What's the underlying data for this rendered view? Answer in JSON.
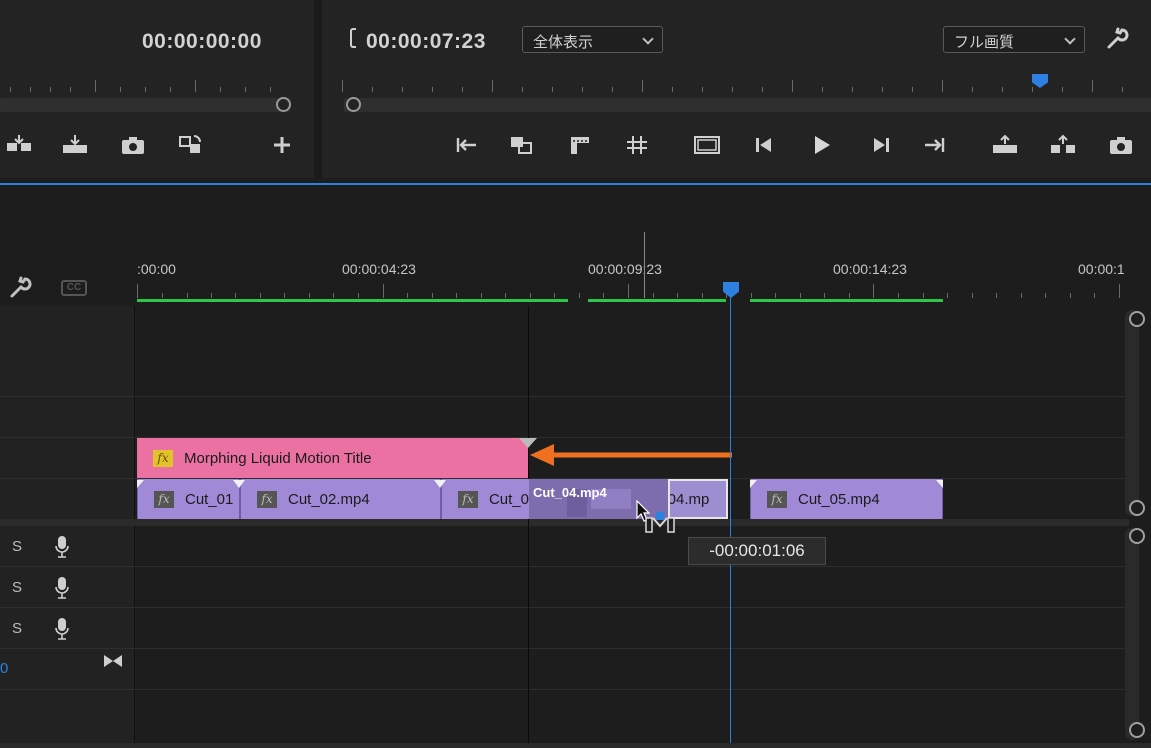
{
  "source_monitor": {
    "timecode": "00:00:00:00"
  },
  "program_monitor": {
    "timecode": "00:00:07:23",
    "zoom_select": "全体表示",
    "quality_select": "フル画質"
  },
  "timeline": {
    "ruler_labels": [
      ":00:00",
      "00:00:04:23",
      "00:00:09:23",
      "00:00:14:23",
      "00:00:1"
    ],
    "clips": {
      "title": "Morphing Liquid Motion Title",
      "cut01": "Cut_01",
      "cut02": "Cut_02.mp4",
      "cut03": "Cut_0",
      "cut04_drag": "Cut_04.mp4",
      "cut04": "Cut_04.mp",
      "cut05": "Cut_05.mp4"
    },
    "fx_label": "fx",
    "audio_s_label": "S",
    "track_zero": "0",
    "tooltip": "-00:00:01:06",
    "cc_label": "CC"
  },
  "colors": {
    "accent_blue": "#2d7fe0",
    "green_bar": "#2fc548",
    "title_clip": "#ec71a3",
    "video_clip": "#a08ad8",
    "arrow": "#f07021"
  }
}
